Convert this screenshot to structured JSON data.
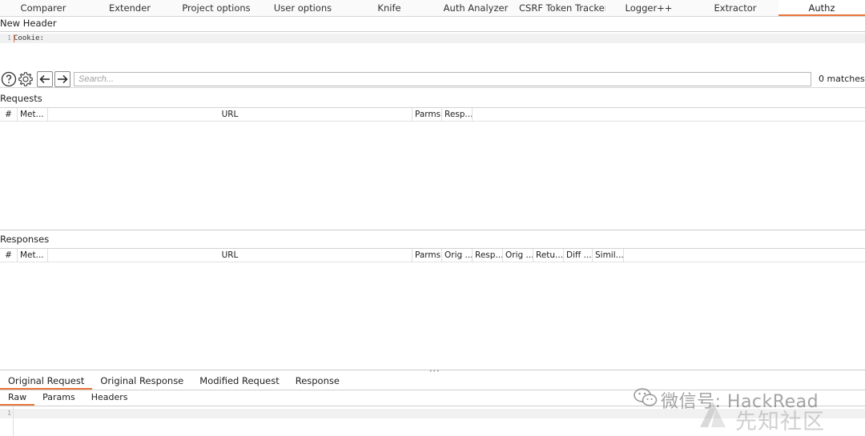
{
  "top_tabs": [
    {
      "label": "Comparer",
      "active": false
    },
    {
      "label": "Extender",
      "active": false
    },
    {
      "label": "Project options",
      "active": false
    },
    {
      "label": "User options",
      "active": false
    },
    {
      "label": "Knife",
      "active": false
    },
    {
      "label": "Auth Analyzer",
      "active": false
    },
    {
      "label": "CSRF Token Tracker",
      "active": false
    },
    {
      "label": "Logger++",
      "active": false
    },
    {
      "label": "Extractor",
      "active": false
    },
    {
      "label": "Authz",
      "active": true
    }
  ],
  "header_section": {
    "title": "New Header",
    "line_number": "1",
    "code": "Cookie:"
  },
  "search": {
    "placeholder": "Search...",
    "matches": "0 matches"
  },
  "requests": {
    "title": "Requests",
    "columns": [
      "#",
      "Met...",
      "URL",
      "Parms",
      "Resp..."
    ]
  },
  "responses": {
    "title": "Responses",
    "columns": [
      "#",
      "Met...",
      "URL",
      "Parms",
      "Orig ...",
      "Resp...",
      "Orig ...",
      "Retu...",
      "Diff ...",
      "Simil..."
    ]
  },
  "bottom_tabs": [
    {
      "label": "Original Request",
      "active": true
    },
    {
      "label": "Original Response",
      "active": false
    },
    {
      "label": "Modified Request",
      "active": false
    },
    {
      "label": "Response",
      "active": false
    }
  ],
  "sub_tabs": [
    {
      "label": "Raw",
      "active": true
    },
    {
      "label": "Params",
      "active": false
    },
    {
      "label": "Headers",
      "active": false
    }
  ],
  "viewer": {
    "line_number": "1"
  },
  "watermark": {
    "line1": "微信号: HackRead",
    "line2": "先知社区"
  },
  "colors": {
    "accent": "#e8743b"
  },
  "icons": [
    "help-icon",
    "settings-gear-icon",
    "arrow-left-icon",
    "arrow-right-icon",
    "wechat-logo-icon",
    "xianzhi-logo-icon"
  ]
}
